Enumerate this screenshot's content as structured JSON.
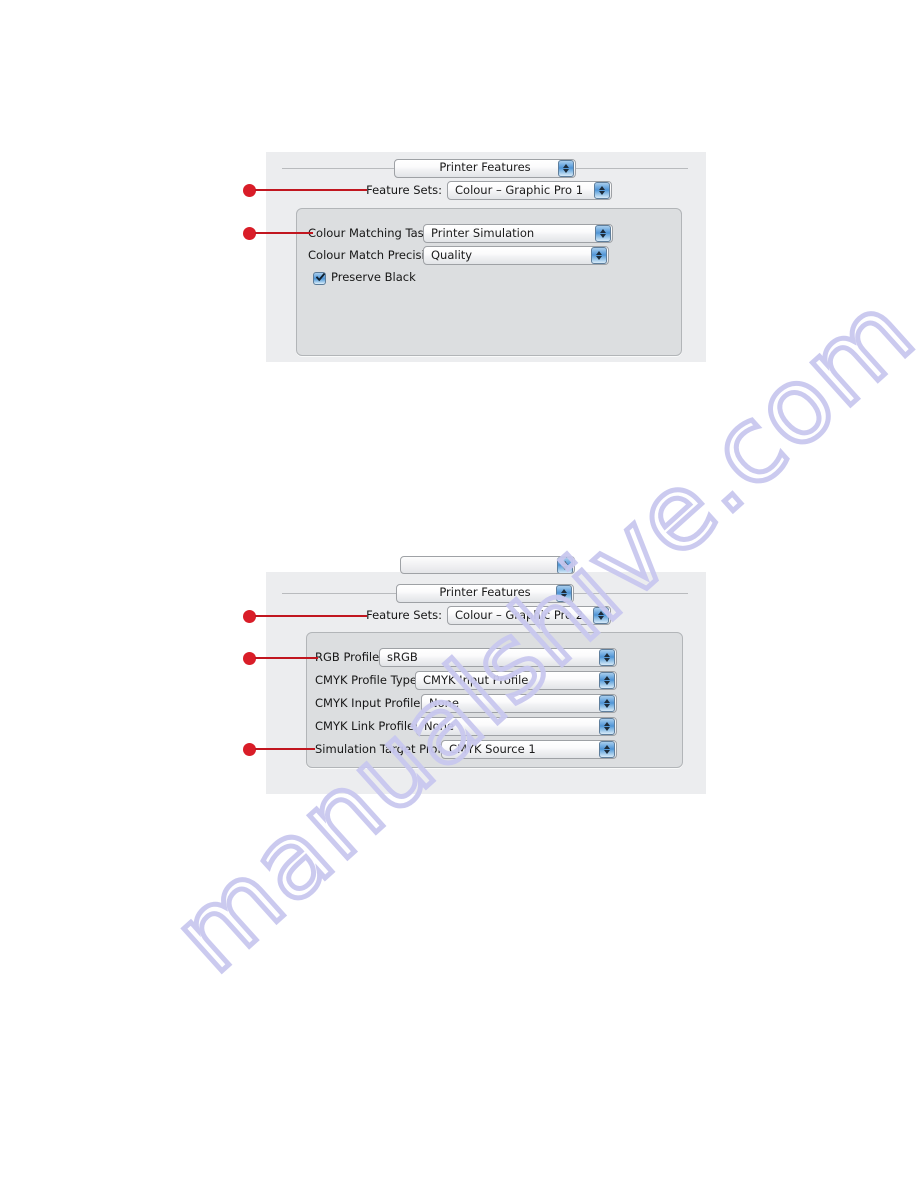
{
  "document": {
    "watermark": "manualshive.com",
    "background_color": "#ffffff"
  },
  "colors": {
    "callout_red": "#d91d28",
    "leader_red": "#c1161f",
    "panel_background": "#ecedef",
    "group_background": "#dcdee0",
    "stepper_blue": "#4e92d4",
    "watermark": "#c9c8ef"
  },
  "panels": [
    {
      "id": "printer-features-graphic-pro-1",
      "pane_selector": {
        "label": "Printer Features",
        "icon": "stepper-updown-icon"
      },
      "feature_sets": {
        "label": "Feature Sets:",
        "value": "Colour – Graphic Pro 1",
        "icon": "stepper-updown-icon"
      },
      "fields": [
        {
          "label": "Colour Matching Task:",
          "value": "Printer Simulation",
          "icon": "stepper-updown-icon"
        },
        {
          "label": "Colour Match Precision:",
          "value": "Quality",
          "icon": "stepper-updown-icon"
        }
      ],
      "checkbox": {
        "label": "Preserve Black",
        "checked": true,
        "icon": "checkmark-icon"
      }
    },
    {
      "id": "printer-features-graphic-pro-2",
      "pane_selector": {
        "label": "Printer Features",
        "icon": "stepper-updown-icon"
      },
      "feature_sets": {
        "label": "Feature Sets:",
        "value": "Colour – Graphic Pro 2",
        "icon": "stepper-updown-icon"
      },
      "fields": [
        {
          "label": "RGB Profile:",
          "value": "sRGB",
          "icon": "stepper-updown-icon"
        },
        {
          "label": "CMYK Profile Type:",
          "value": "CMYK Input Profile",
          "icon": "stepper-updown-icon"
        },
        {
          "label": "CMYK Input Profile:",
          "value": "None",
          "icon": "stepper-updown-icon"
        },
        {
          "label": "CMYK Link Profile:",
          "value": "None",
          "icon": "stepper-updown-icon"
        },
        {
          "label": "Simulation Target Profile:",
          "value": "CMYK Source 1",
          "icon": "stepper-updown-icon"
        }
      ]
    }
  ],
  "callouts": [
    {
      "id": "p1-feature-sets",
      "target": "Feature Sets:"
    },
    {
      "id": "p1-colour-matching",
      "target": "Colour Matching Task:"
    },
    {
      "id": "p2-feature-sets",
      "target": "Feature Sets:"
    },
    {
      "id": "p2-rgb-profile",
      "target": "RGB Profile:"
    },
    {
      "id": "p2-simulation-target",
      "target": "Simulation Target Profile:"
    }
  ]
}
